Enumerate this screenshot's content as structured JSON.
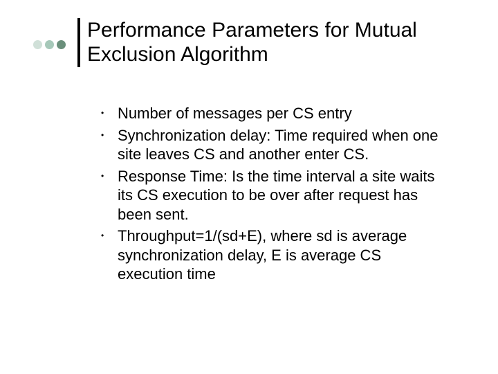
{
  "title": "Performance Parameters for Mutual Exclusion Algorithm",
  "bullets": [
    "Number of messages per CS entry",
    "Synchronization delay: Time required when one site leaves CS and another enter CS.",
    "Response Time: Is the time interval a site waits its CS execution to be over after request has been sent.",
    "Throughput=1/(sd+E), where sd is average synchronization delay, E is average CS execution time"
  ]
}
